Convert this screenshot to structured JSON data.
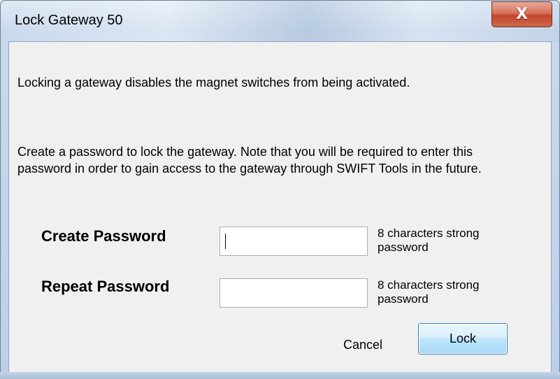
{
  "window": {
    "title": "Lock Gateway 50",
    "close_label": "X"
  },
  "body": {
    "intro_text": "Locking a gateway disables the magnet switches from being activated.",
    "instruction_text": "Create a password to lock the gateway. Note that you will be required to enter this password in order to gain access to the gateway through SWIFT Tools in the future."
  },
  "form": {
    "create_label": "Create Password",
    "create_value": "",
    "create_hint": "8 characters strong password",
    "repeat_label": "Repeat Password",
    "repeat_value": "",
    "repeat_hint": "8 characters strong password"
  },
  "buttons": {
    "cancel_label": "Cancel",
    "lock_label": "Lock"
  }
}
